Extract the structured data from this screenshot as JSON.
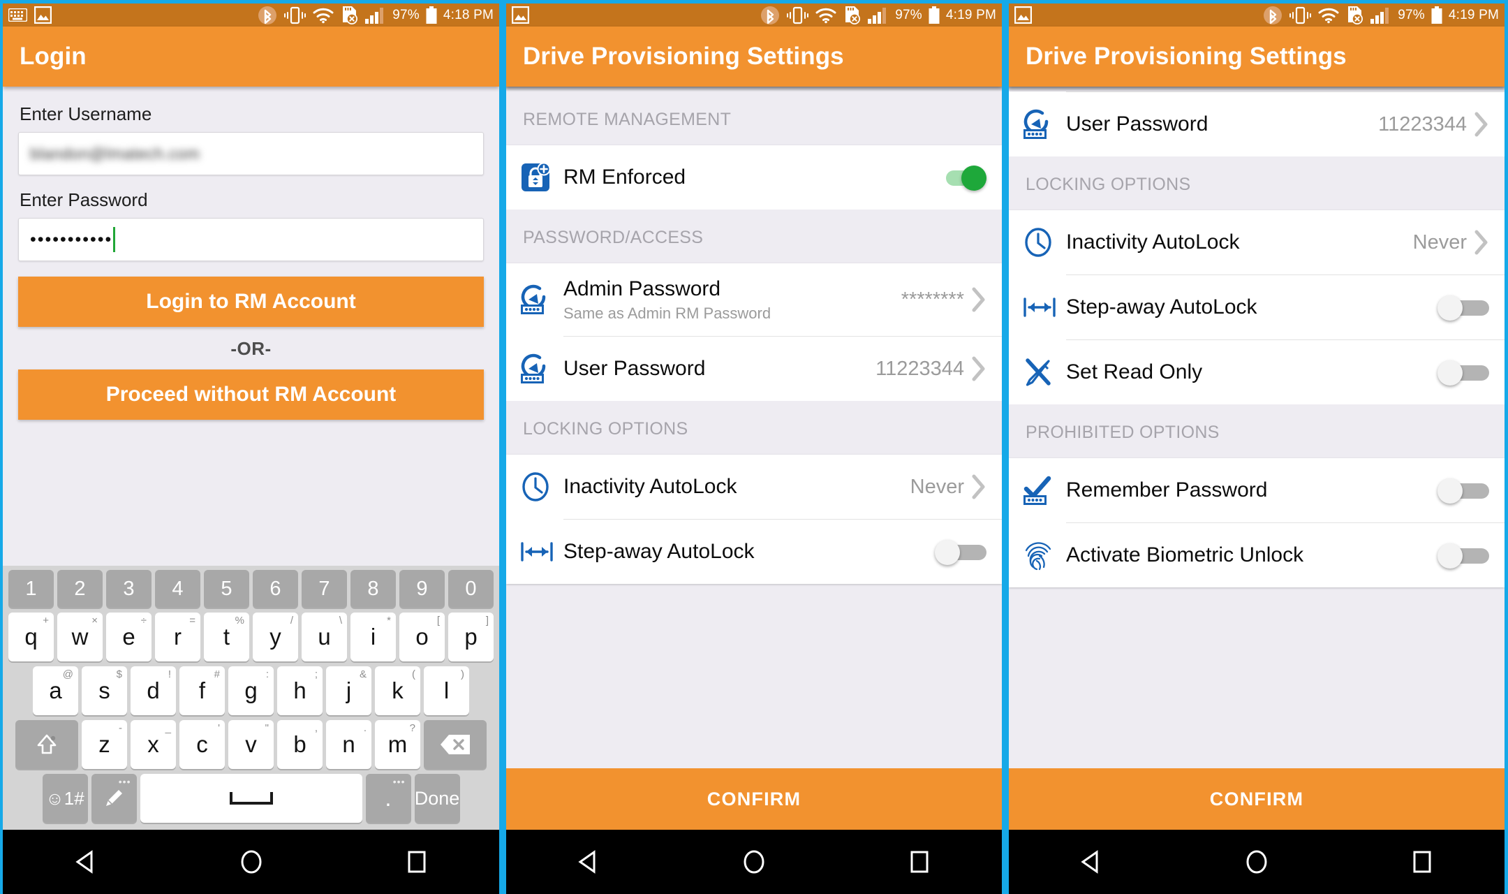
{
  "statusbar": {
    "battery": "97%",
    "time_p1": "4:18 PM",
    "time_p2": "4:19 PM",
    "time_p3": "4:19 PM",
    "icons": [
      "keyboard-icon",
      "image-icon",
      "bluetooth-icon",
      "vibrate-icon",
      "wifi-icon",
      "sdcard-error-icon",
      "signal-icon",
      "battery-icon"
    ]
  },
  "theme": {
    "accent_orange": "#f2922f",
    "statusbar_orange": "#c4741c",
    "border_blue": "#16a9e8",
    "toggle_on_green": "#1ea83a",
    "icon_blue": "#1763b6",
    "muted_gray": "#9b9b9b"
  },
  "panel1": {
    "title": "Login",
    "username_label": "Enter Username",
    "username_value": "blandon@lmatech.com",
    "password_label": "Enter Password",
    "password_value": "•••••••••••",
    "login_button": "Login to RM Account",
    "or_text": "-OR-",
    "proceed_button": "Proceed without RM Account",
    "keyboard": {
      "row_numbers": [
        "1",
        "2",
        "3",
        "4",
        "5",
        "6",
        "7",
        "8",
        "9",
        "0"
      ],
      "row_q": [
        {
          "main": "q",
          "alt": "+"
        },
        {
          "main": "w",
          "alt": "×"
        },
        {
          "main": "e",
          "alt": "÷"
        },
        {
          "main": "r",
          "alt": "="
        },
        {
          "main": "t",
          "alt": "%"
        },
        {
          "main": "y",
          "alt": "/"
        },
        {
          "main": "u",
          "alt": "\\"
        },
        {
          "main": "i",
          "alt": "*"
        },
        {
          "main": "o",
          "alt": "["
        },
        {
          "main": "p",
          "alt": "]"
        }
      ],
      "row_a": [
        {
          "main": "a",
          "alt": "@"
        },
        {
          "main": "s",
          "alt": "$"
        },
        {
          "main": "d",
          "alt": "!"
        },
        {
          "main": "f",
          "alt": "#"
        },
        {
          "main": "g",
          "alt": ":"
        },
        {
          "main": "h",
          "alt": ";"
        },
        {
          "main": "j",
          "alt": "&"
        },
        {
          "main": "k",
          "alt": "("
        },
        {
          "main": "l",
          "alt": ")"
        }
      ],
      "row_z": [
        {
          "main": "z",
          "alt": "-"
        },
        {
          "main": "x",
          "alt": "_"
        },
        {
          "main": "c",
          "alt": "'"
        },
        {
          "main": "v",
          "alt": "\""
        },
        {
          "main": "b",
          "alt": ","
        },
        {
          "main": "n",
          "alt": "."
        },
        {
          "main": "m",
          "alt": "?"
        }
      ],
      "shift_key": "shift-icon",
      "backspace_key": "backspace-icon",
      "symbols_key": "☺1#",
      "pencil_key": "pencil-icon",
      "space_key": "space-icon",
      "period_key": ".",
      "done_key": "Done"
    }
  },
  "panel2": {
    "title": "Drive Provisioning Settings",
    "sections": [
      {
        "header": "REMOTE MANAGEMENT",
        "rows": [
          {
            "icon": "lock-add-icon",
            "title": "RM Enforced",
            "control": "toggle",
            "state": "on"
          }
        ]
      },
      {
        "header": "PASSWORD/ACCESS",
        "rows": [
          {
            "icon": "password-reset-icon",
            "title": "Admin Password",
            "subtitle": "Same as Admin RM Password",
            "value": "********",
            "control": "chevron"
          },
          {
            "icon": "password-reset-icon",
            "title": "User Password",
            "value": "11223344",
            "control": "chevron"
          }
        ]
      },
      {
        "header": "LOCKING OPTIONS",
        "rows": [
          {
            "icon": "clock-icon",
            "title": "Inactivity AutoLock",
            "value": "Never",
            "control": "chevron"
          },
          {
            "icon": "arrows-horizontal-icon",
            "title": "Step-away AutoLock",
            "control": "toggle",
            "state": "off"
          }
        ]
      }
    ],
    "confirm_button": "CONFIRM"
  },
  "panel3": {
    "title": "Drive Provisioning Settings",
    "sections": [
      {
        "header": "",
        "rows": [
          {
            "icon": "password-reset-icon",
            "title": "User Password",
            "value": "11223344",
            "control": "chevron"
          }
        ]
      },
      {
        "header": "LOCKING OPTIONS",
        "rows": [
          {
            "icon": "clock-icon",
            "title": "Inactivity AutoLock",
            "value": "Never",
            "control": "chevron"
          },
          {
            "icon": "arrows-horizontal-icon",
            "title": "Step-away AutoLock",
            "control": "toggle",
            "state": "off"
          },
          {
            "icon": "read-only-icon",
            "title": "Set Read Only",
            "control": "toggle",
            "state": "off"
          }
        ]
      },
      {
        "header": "PROHIBITED OPTIONS",
        "rows": [
          {
            "icon": "remember-password-icon",
            "title": "Remember Password",
            "control": "toggle",
            "state": "off"
          },
          {
            "icon": "fingerprint-icon",
            "title": "Activate Biometric Unlock",
            "control": "toggle",
            "state": "off"
          }
        ]
      }
    ],
    "confirm_button": "CONFIRM"
  },
  "navbar": {
    "back": "back-triangle-icon",
    "home": "home-circle-icon",
    "recents": "recents-square-icon"
  }
}
